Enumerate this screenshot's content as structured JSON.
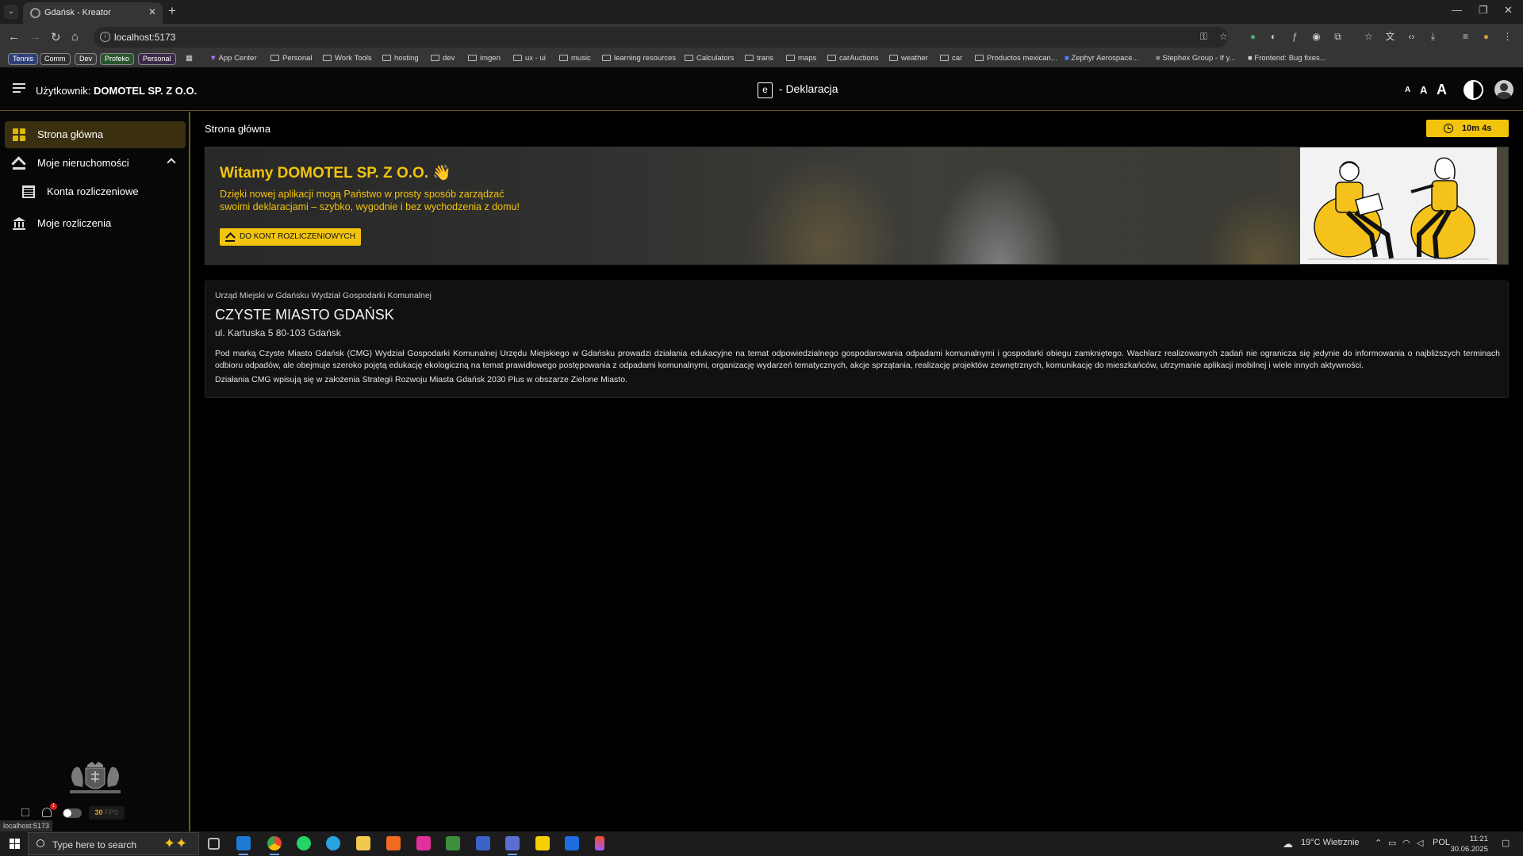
{
  "browser": {
    "tab_title": "Gdańsk - Kreator",
    "url": "localhost:5173",
    "status_url": "localhost:5173",
    "bookmark_pills": [
      "Tennis",
      "Comm",
      "Dev",
      "Profeko",
      "Personal"
    ],
    "bookmarks": [
      "App Center",
      "Personal",
      "Work Tools",
      "hosting",
      "dev",
      "imgen",
      "ux - ui",
      "music",
      "learning resources",
      "Calculators",
      "trans",
      "maps",
      "carAuctions",
      "weather",
      "car",
      "Productos mexican...",
      "Zephyr Aerospace...",
      "Stephex Group - If y...",
      "Frontend: Bug fixes..."
    ],
    "bookmark_pill_colors": [
      "#2f3f7a",
      "#303030",
      "#3a3a3a",
      "#28552c",
      "#3a2a4a"
    ]
  },
  "header": {
    "user_prefix": "Użytkownik:",
    "user_name": "DOMOTEL SP. Z O.O.",
    "brand_letter": "e",
    "brand_text": "- Deklaracja",
    "font_size_labels": [
      "A",
      "A",
      "A"
    ]
  },
  "sidebar": {
    "items": [
      {
        "label": "Strona główna",
        "icon": "dashboard-grid-icon",
        "active": true
      },
      {
        "label": "Moje nieruchomości",
        "icon": "house-icon",
        "expanded": true
      },
      {
        "label": "Konta rozliczeniowe",
        "icon": "building-icon",
        "child": true
      },
      {
        "label": "Moje rozliczenia",
        "icon": "bank-icon"
      }
    ],
    "notification_count": "1",
    "fps_value": "30",
    "fps_unit": "FPS"
  },
  "main": {
    "page_title": "Strona główna",
    "timer": "10m 4s",
    "hero": {
      "greeting": "Witamy DOMOTEL SP. Z O.O. 👋",
      "subtitle": "Dzięki nowej aplikacji mogą Państwo w prosty sposób zarządzać swoimi deklaracjami – szybko, wygodnie i bez wychodzenia z domu!",
      "cta_label": "DO KONT ROZLICZENIOWYCH"
    },
    "info": {
      "organization": "Urząd Miejski w Gdańsku Wydział Gospodarki Komunalnej",
      "title": "CZYSTE MIASTO GDAŃSK",
      "address": "ul. Kartuska 5 80-103 Gdańsk",
      "paragraph1": "Pod marką Czyste Miasto Gdańsk (CMG) Wydział Gospodarki Komunalnej Urzędu Miejskiego w Gdańsku prowadzi działania edukacyjne na temat odpowiedzialnego gospodarowania odpadami komunalnymi i gospodarki obiegu zamkniętego. Wachlarz realizowanych zadań nie ogranicza się jedynie do informowania o najbliższych terminach odbioru odpadów, ale obejmuje szeroko pojętą edukację ekologiczną na temat prawidłowego postępowania z odpadami komunalnymi, organizację wydarzeń tematycznych, akcje sprzątania, realizację projektów zewnętrznych, komunikację do mieszkańców, utrzymanie aplikacji mobilnej i wiele innych aktywności.",
      "paragraph2": "Działania CMG wpisują się w założenia Strategii Rozwoju Miasta Gdańsk 2030 Plus w obszarze Zielone Miasto."
    }
  },
  "taskbar": {
    "search_placeholder": "Type here to search",
    "weather": "19°C  Wietrznie",
    "language": "POL",
    "time": "11:21",
    "date": "30.06.2025"
  },
  "colors": {
    "accent": "#f2c40d",
    "active_bg": "#3a3010",
    "divider": "#6a5a1a"
  }
}
